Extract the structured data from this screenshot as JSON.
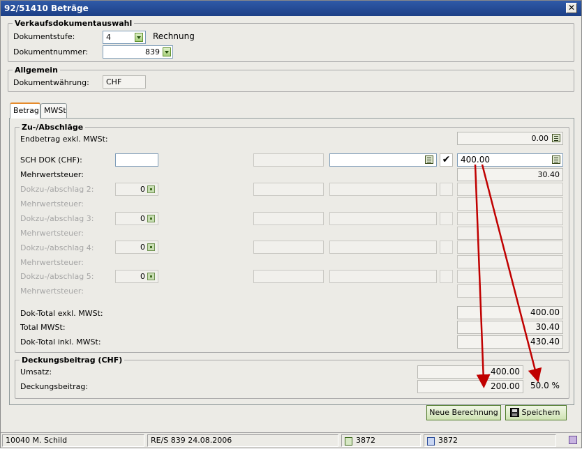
{
  "window": {
    "title": "92/51410 Beträge",
    "close_label": "✕"
  },
  "verkauf": {
    "legend": "Verkaufsdokumentauswahl",
    "stufe_label": "Dokumentstufe:",
    "stufe_value": "4",
    "stufe_text": "Rechnung",
    "nummer_label": "Dokumentnummer:",
    "nummer_value": "839"
  },
  "allgemein": {
    "legend": "Allgemein",
    "waehrung_label": "Dokumentwährung:",
    "waehrung_value": "CHF"
  },
  "tabs": [
    {
      "label": "Betrag",
      "active": true
    },
    {
      "label": "MWSt",
      "active": false
    }
  ],
  "zu": {
    "legend": "Zu-/Abschläge",
    "endbetrag_label": "Endbetrag exkl. MWSt:",
    "endbetrag_value": "0.00",
    "sch_label": "SCH DOK (CHF):",
    "sch_checkbox": "✔",
    "sch_amount": "400.00",
    "mwst_label": "Mehrwertsteuer:",
    "mwst_value": "30.40",
    "dokzu2_label": "Dokzu-/abschlag 2:",
    "dokzu2_value": "0",
    "mwst2_label": "Mehrwertsteuer:",
    "dokzu3_label": "Dokzu-/abschlag 3:",
    "dokzu3_value": "0",
    "mwst3_label": "Mehrwertsteuer:",
    "dokzu4_label": "Dokzu-/abschlag 4:",
    "dokzu4_value": "0",
    "mwst4_label": "Mehrwertsteuer:",
    "dokzu5_label": "Dokzu-/abschlag 5:",
    "dokzu5_value": "0",
    "mwst5_label": "Mehrwertsteuer:",
    "total_exkl_label": "Dok-Total exkl. MWSt:",
    "total_exkl_value": "400.00",
    "total_mwst_label": "Total MWSt:",
    "total_mwst_value": "30.40",
    "total_inkl_label": "Dok-Total inkl. MWSt:",
    "total_inkl_value": "430.40"
  },
  "deckung": {
    "legend": "Deckungsbeitrag (CHF)",
    "umsatz_label": "Umsatz:",
    "umsatz_value": "400.00",
    "beitrag_label": "Deckungsbeitrag:",
    "beitrag_value": "200.00",
    "percent": "50.0 %"
  },
  "buttons": {
    "neue_berechnung": "Neue Berechnung",
    "speichern": "Speichern"
  },
  "statusbar": {
    "user": "10040 M. Schild",
    "doc": "RE/S 839  24.08.2006",
    "count1": "3872",
    "count2": "3872"
  },
  "annotation_color": "#c00000"
}
